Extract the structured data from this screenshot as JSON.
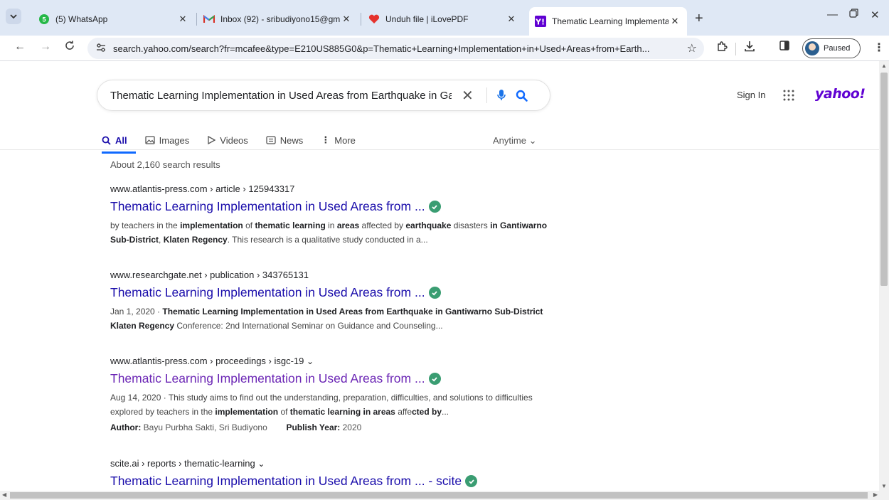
{
  "browser": {
    "tabs": [
      {
        "title": "(5) WhatsApp",
        "icon": "whatsapp-icon",
        "badge": "5"
      },
      {
        "title": "Inbox (92) - sribudiyono15@gm",
        "icon": "gmail-icon"
      },
      {
        "title": "Unduh file | iLovePDF",
        "icon": "ilovepdf-icon"
      },
      {
        "title": "Thematic Learning Implementat",
        "icon": "yahoo-icon"
      }
    ],
    "url": "search.yahoo.com/search?fr=mcafee&type=E210US885G0&p=Thematic+Learning+Implementation+in+Used+Areas+from+Earth...",
    "profile_status": "Paused"
  },
  "search": {
    "query": "Thematic Learning Implementation in Used Areas from Earthquake in Gantiwarno Sub-District Klaten Regency",
    "sign_in": "Sign In",
    "logo": "yahoo!",
    "tabs": [
      "All",
      "Images",
      "Videos",
      "News",
      "More"
    ],
    "time_filter": "Anytime",
    "result_count": "About 2,160 search results"
  },
  "results": [
    {
      "crumb": "www.atlantis-press.com › article › 125943317",
      "title": "Thematic Learning Implementation in Used Areas from ...",
      "snippet_html": "by teachers in the <b>implementation</b> of <b>thematic learning</b> in <b>areas</b> affected by <b>earthquake</b> disasters <b>in Gantiwarno Sub-District</b>, <b>Klaten Regency</b>. This research is a qualitative study conducted in a..."
    },
    {
      "crumb": "www.researchgate.net › publication › 343765131",
      "title": "Thematic Learning Implementation in Used Areas from ...",
      "snippet_html": "Jan 1, 2020 · <b>Thematic Learning Implementation in Used Areas from Earthquake in Gantiwarno Sub-District Klaten Regency</b> Conference: 2nd International Seminar on Guidance and Counseling..."
    },
    {
      "crumb": "www.atlantis-press.com › proceedings › isgc-19",
      "title": "Thematic Learning Implementation in Used Areas from ...",
      "snippet_html": "Aug 14, 2020 · This study aims to find out the understanding, preparation, difficulties, and solutions to difficulties explored by teachers in the <b>implementation</b> of <b>thematic learning in areas</b> affe<b>cted by</b>...",
      "author_label": "Author:",
      "author": "Bayu Purbha Sakti, Sri Budiyono",
      "year_label": "Publish Year:",
      "year": "2020"
    },
    {
      "crumb": "scite.ai › reports › thematic-learning",
      "title": "Thematic Learning Implementation in Used Areas from ... - scite"
    }
  ],
  "colors": {
    "link": "#1a0dab",
    "visited": "#6b26b5",
    "yahoo": "#6001d2",
    "accent": "#0f69ff"
  }
}
